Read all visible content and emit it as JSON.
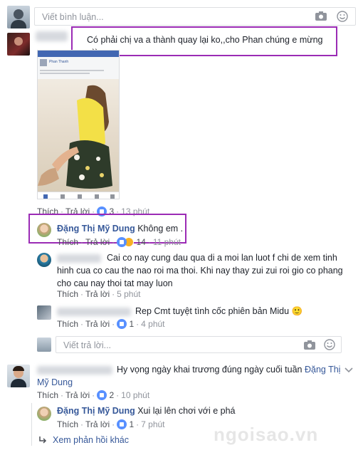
{
  "top_input": {
    "placeholder": "Viết bình luận..."
  },
  "comment1": {
    "author": "Phan Phúc",
    "text": "Có phải chị va a thành quay lại ko,,cho Phan chúng e mừng :-))",
    "actions": {
      "like": "Thích",
      "reply": "Trả lời",
      "like_count": "3",
      "time": "13 phút"
    },
    "image": {
      "phone_name": "Phan Thanh"
    }
  },
  "reply1": {
    "author": "Đặng Thị Mỹ Dung",
    "text": "Không em .",
    "actions": {
      "like": "Thích",
      "reply": "Trả lời",
      "like_count": "14",
      "time": "11 phút"
    }
  },
  "reply2": {
    "text": "Cai co nay cung dau qua di a moi lan luot f chi de xem tinh hinh cua co cau the nao roi ma thoi. Khi nay thay zui zui roi gio co phang cho cau nay thoi tat may luon",
    "actions": {
      "like": "Thích",
      "reply": "Trả lời",
      "time": "5 phút"
    }
  },
  "reply3": {
    "author": "Đức Tuấn",
    "text": "Rep Cmt tuyệt tình cốc phiên bản Midu 🙂",
    "actions": {
      "like": "Thích",
      "reply": "Trả lời",
      "like_count": "1",
      "time": "4 phút"
    }
  },
  "reply_input": {
    "placeholder": "Viết trả lời..."
  },
  "comment2": {
    "author_blur": "Phan Công Dũng",
    "text": "Hy vọng ngày khai trương đúng ngày cuối tuần",
    "mention_line1": "Đặng Thị",
    "mention_line2": "Mỹ Dung",
    "actions": {
      "like": "Thích",
      "reply": "Trả lời",
      "like_count": "2",
      "time": "10 phút"
    }
  },
  "reply4": {
    "author": "Đặng Thị Mỹ Dung",
    "text": "Xui lại lên chơi với e phá",
    "actions": {
      "like": "Thích",
      "reply": "Trả lời",
      "like_count": "1",
      "time": "7 phút"
    }
  },
  "more_replies": {
    "label": "Xem phản hồi khác"
  },
  "watermark": {
    "text": "ngoisao.vn"
  },
  "colors": {
    "link": "#365899",
    "highlight": "#9b2bb5",
    "like": "#5890ff"
  }
}
